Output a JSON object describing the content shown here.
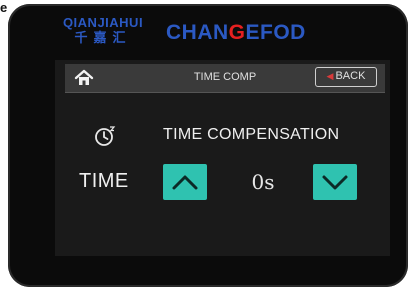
{
  "corner_letter": "e",
  "brand": {
    "left_en": "QIANJIAHUI",
    "left_cn": "千嘉汇",
    "right_pre": "CHAN",
    "right_mark": "G",
    "right_post": "EFOD"
  },
  "header": {
    "title": "TIME COMP",
    "back_label": "BACK"
  },
  "main": {
    "heading": "TIME COMPENSATION",
    "row_label": "TIME",
    "value": "0s"
  },
  "colors": {
    "accent": "#2fc2b0",
    "brand_blue": "#2b59c3",
    "back_arrow": "#d83a3a"
  },
  "icons": {
    "home": "home-icon",
    "clock": "clock-icon",
    "back_arrow": "back-arrow-icon",
    "up": "chevron-up-icon",
    "down": "chevron-down-icon"
  }
}
